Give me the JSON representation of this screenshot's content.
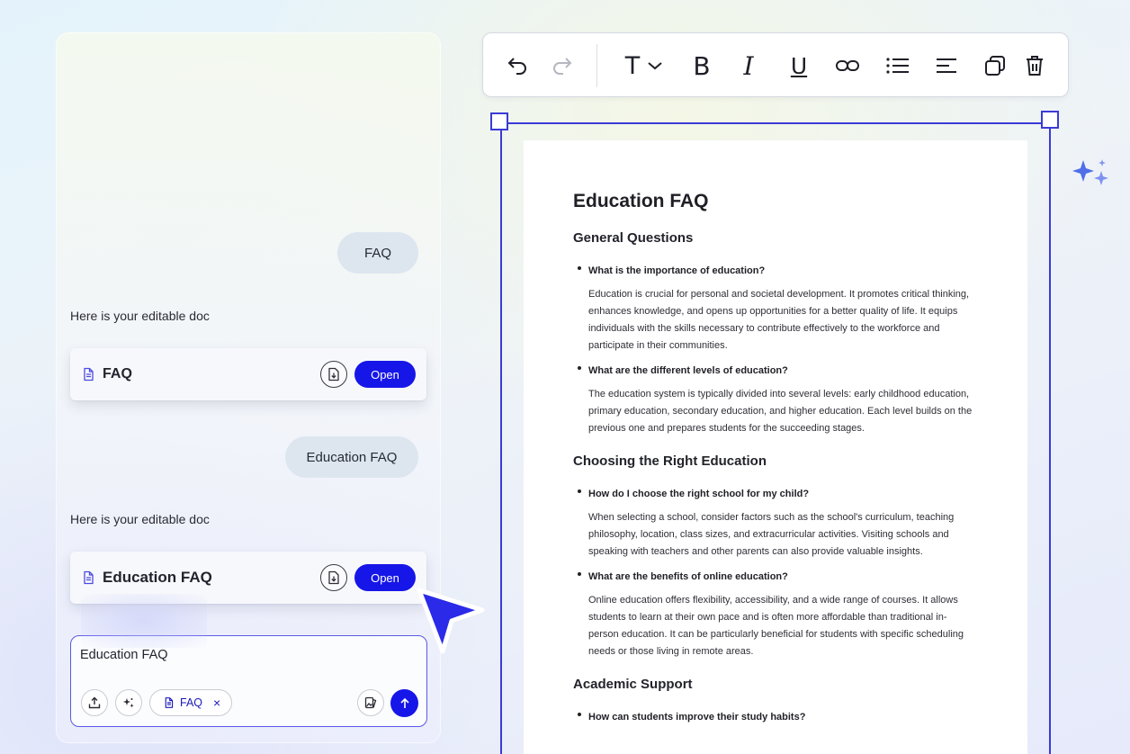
{
  "chat": {
    "messages": [
      {
        "role": "user",
        "text": "FAQ"
      },
      {
        "role": "assistant",
        "text": "Here is your editable doc"
      },
      {
        "role": "user",
        "text": "Education FAQ"
      },
      {
        "role": "assistant",
        "text": "Here is your editable doc"
      }
    ],
    "cards": [
      {
        "title": "FAQ",
        "button": "Open"
      },
      {
        "title": "Education FAQ",
        "button": "Open"
      }
    ],
    "composer": {
      "value": "Education FAQ",
      "attachment_chip": "FAQ",
      "chip_close": "×"
    }
  },
  "toolbar": {
    "icons": [
      "undo-icon",
      "redo-icon",
      "text-style-icon",
      "chevron-down-icon",
      "bold-icon",
      "italic-icon",
      "underline-icon",
      "link-icon",
      "bullet-list-icon",
      "align-icon",
      "duplicate-icon",
      "delete-icon"
    ],
    "text_style_letter": "T",
    "bold_letter": "B",
    "italic_letter": "I",
    "underline_letter": "U"
  },
  "document": {
    "title": "Education FAQ",
    "sections": [
      {
        "heading": "General Questions",
        "items": [
          {
            "q": "What is the importance of education?",
            "a": "Education is crucial for personal and societal development. It promotes critical thinking, enhances knowledge, and opens up opportunities for a better quality of life. It equips individuals with the skills necessary to contribute effectively to the workforce and participate in their communities."
          },
          {
            "q": "What are the different levels of education?",
            "a": "The education system is typically divided into several levels: early childhood education, primary education, secondary education, and higher education. Each level builds on the previous one and prepares students for the succeeding stages."
          }
        ]
      },
      {
        "heading": "Choosing the Right Education",
        "items": [
          {
            "q": "How do I choose the right school for my child?",
            "a": "When selecting a school, consider factors such as the school's curriculum, teaching philosophy, location, class sizes, and extracurricular activities. Visiting schools and speaking with teachers and other parents can also provide valuable insights."
          },
          {
            "q": "What are the benefits of online education?",
            "a": "Online education offers flexibility, accessibility, and a wide range of courses. It allows students to learn at their own pace and is often more affordable than traditional in-person education. It can be particularly beneficial for students with specific scheduling needs or those living in remote areas."
          }
        ]
      },
      {
        "heading": "Academic Support",
        "items": [
          {
            "q": "How can students improve their study habits?",
            "a": ""
          }
        ]
      }
    ]
  },
  "colors": {
    "accent": "#1616e8",
    "selection": "#3b3bd6",
    "user_bubble": "#dde6ef"
  }
}
